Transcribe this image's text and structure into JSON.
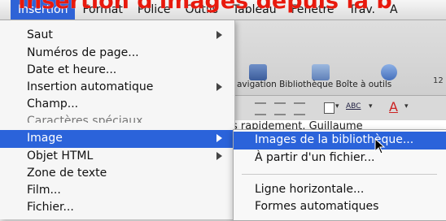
{
  "headline": "Insertion d'images depuis la b",
  "menubar": {
    "items": [
      "Insertion",
      "Format",
      "Police",
      "Outils",
      "Tableau",
      "Fenêtre",
      "Trav.",
      "A"
    ],
    "active_index": 0
  },
  "background_app": {
    "toolbar_labels": [
      "avigation",
      "Bibliothèque",
      "Boîte à outils"
    ],
    "zoom_text": "12",
    "document_text": "s rapidement. Guillaume"
  },
  "insert_menu": {
    "items": [
      {
        "label": "Saut",
        "submenu": true
      },
      {
        "label": "Numéros de page...",
        "submenu": false
      },
      {
        "label": "Date et heure...",
        "submenu": false
      },
      {
        "label": "Insertion automatique",
        "submenu": true
      },
      {
        "label": "Champ...",
        "submenu": false
      },
      {
        "label": "Caractères spéciaux...",
        "submenu": false
      },
      {
        "label": "Image",
        "submenu": true
      },
      {
        "label": "Objet HTML",
        "submenu": true
      },
      {
        "label": "Zone de texte",
        "submenu": false
      },
      {
        "label": "Film...",
        "submenu": false
      },
      {
        "label": "Fichier...",
        "submenu": false
      }
    ]
  },
  "image_submenu": {
    "items": [
      {
        "label": "Images de la bibliothèque..."
      },
      {
        "label": "À partir d'un fichier..."
      },
      {
        "label": "Ligne horizontale..."
      },
      {
        "label": "Formes automatiques"
      }
    ]
  },
  "colors": {
    "highlight": "#2b63da",
    "headline": "#e8190d"
  }
}
